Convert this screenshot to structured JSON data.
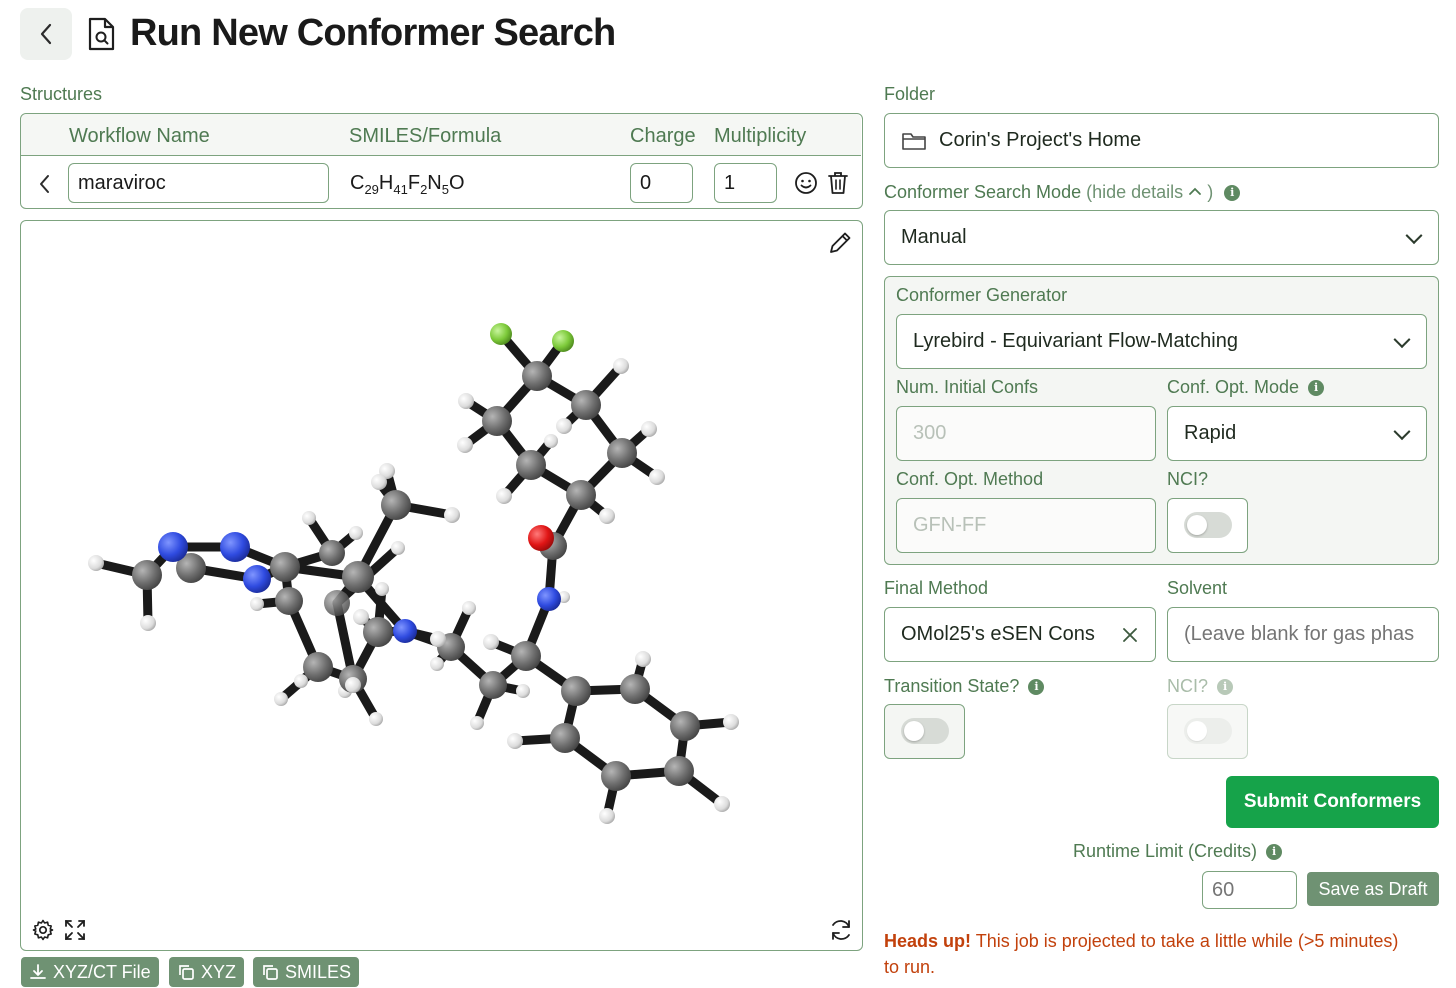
{
  "header": {
    "title": "Run New Conformer Search"
  },
  "structures": {
    "section_label": "Structures",
    "columns": [
      "Workflow Name",
      "SMILES/Formula",
      "Charge",
      "Multiplicity"
    ],
    "row": {
      "name": "maraviroc",
      "formula": {
        "c": "C",
        "c_n": "29",
        "h": "H",
        "h_n": "41",
        "f": "F",
        "f_n": "2",
        "n": "N",
        "n_n": "5",
        "o": "O"
      },
      "charge": "0",
      "multiplicity": "1"
    }
  },
  "viewer": {
    "buttons": {
      "xyz_file": "XYZ/CT File",
      "xyz": "XYZ",
      "smiles": "SMILES"
    }
  },
  "folder": {
    "label": "Folder",
    "value": "Corin's Project's Home"
  },
  "mode": {
    "label": "Conformer Search Mode",
    "toggle_text": "(hide details",
    "toggle_end": ")",
    "value": "Manual"
  },
  "generator": {
    "label": "Conformer Generator",
    "value": "Lyrebird - Equivariant Flow-Matching",
    "num_confs_label": "Num. Initial Confs",
    "num_confs_value": "300",
    "opt_mode_label": "Conf. Opt. Mode",
    "opt_mode_value": "Rapid",
    "opt_method_label": "Conf. Opt. Method",
    "opt_method_value": "GFN-FF",
    "nci_label": "NCI?",
    "nci_on": false
  },
  "final": {
    "method_label": "Final Method",
    "method_value": "OMol25's eSEN Cons",
    "solvent_label": "Solvent",
    "solvent_placeholder": "(Leave blank for gas phas",
    "ts_label": "Transition State?",
    "nci_label": "NCI?"
  },
  "actions": {
    "submit": "Submit Conformers",
    "runtime_label": "Runtime Limit (Credits)",
    "runtime_value": "60",
    "draft": "Save as Draft"
  },
  "warning": {
    "bold": "Heads up!",
    "text": "This job is projected to take a little while (>5 minutes)",
    "text2": "to run."
  },
  "colors": {
    "accent": "#16a34a",
    "label_green": "#4f7a52",
    "border": "#7da37f",
    "warning": "#c2410c"
  }
}
